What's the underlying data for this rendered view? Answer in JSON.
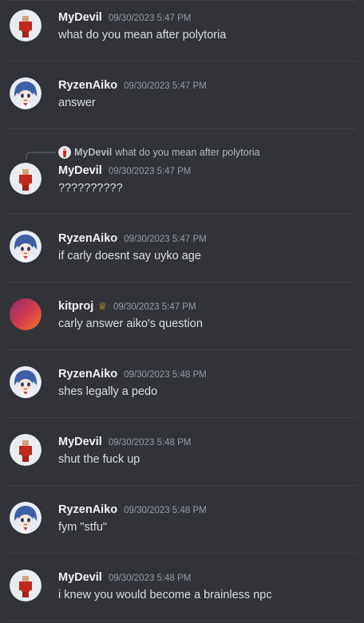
{
  "messages": [
    {
      "author": "MyDevil",
      "timestamp": "09/30/2023 5:47 PM",
      "text": "what do you mean after polytoria",
      "avatar": "roblox-red-avatar"
    },
    {
      "author": "RyzenAiko",
      "timestamp": "09/30/2023 5:47 PM",
      "text": "answer",
      "avatar": "anime-girl-avatar"
    },
    {
      "author": "MyDevil",
      "timestamp": "09/30/2023 5:47 PM",
      "text": "??????????",
      "avatar": "roblox-red-avatar",
      "reply": {
        "author": "MyDevil",
        "text": "what do you mean after polytoria"
      }
    },
    {
      "author": "RyzenAiko",
      "timestamp": "09/30/2023 5:47 PM",
      "text": "if carly doesnt say uyko age",
      "avatar": "anime-girl-avatar"
    },
    {
      "author": "kitproj",
      "timestamp": "09/30/2023 5:47 PM",
      "text": "carly answer aiko's question",
      "avatar": "gradient-avatar",
      "badge": "crown-icon",
      "badge_color": "#f0b232"
    },
    {
      "author": "RyzenAiko",
      "timestamp": "09/30/2023 5:48 PM",
      "text": "shes legally a pedo",
      "avatar": "anime-girl-avatar"
    },
    {
      "author": "MyDevil",
      "timestamp": "09/30/2023 5:48 PM",
      "text": "shut the fuck up",
      "avatar": "roblox-red-avatar"
    },
    {
      "author": "RyzenAiko",
      "timestamp": "09/30/2023 5:48 PM",
      "text": "fym \"stfu\"",
      "avatar": "anime-girl-avatar"
    },
    {
      "author": "MyDevil",
      "timestamp": "09/30/2023 5:48 PM",
      "text": "i knew you would become a brainless npc",
      "avatar": "roblox-red-avatar"
    }
  ],
  "colors": {
    "background": "#313338",
    "username": "#f2f3f5",
    "message_text": "#dbdee1",
    "timestamp": "#949ba4",
    "divider": "#3f4147"
  }
}
